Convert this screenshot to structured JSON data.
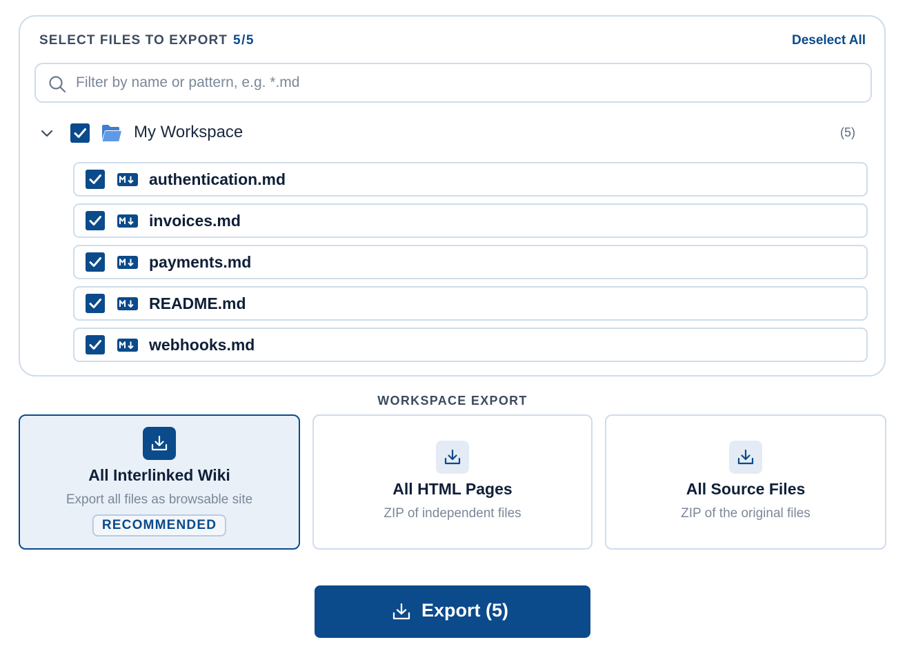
{
  "selection": {
    "title": "SELECT FILES TO EXPORT",
    "count": "5/5",
    "deselect_label": "Deselect All",
    "search_placeholder": "Filter by name or pattern, e.g. *.md",
    "search_value": ""
  },
  "workspace": {
    "name": "My Workspace",
    "count": "(5)",
    "expanded": true,
    "checked": true,
    "icon": "folder-open-icon"
  },
  "files": [
    {
      "name": "authentication.md",
      "checked": true,
      "icon": "markdown-icon"
    },
    {
      "name": "invoices.md",
      "checked": true,
      "icon": "markdown-icon"
    },
    {
      "name": "payments.md",
      "checked": true,
      "icon": "markdown-icon"
    },
    {
      "name": "README.md",
      "checked": true,
      "icon": "markdown-icon"
    },
    {
      "name": "webhooks.md",
      "checked": true,
      "icon": "markdown-icon"
    }
  ],
  "export_section": {
    "label": "WORKSPACE EXPORT",
    "options": [
      {
        "title": "All Interlinked Wiki",
        "description": "Export all files as browsable site",
        "badge": "RECOMMENDED",
        "selected": true,
        "icon": "download-icon"
      },
      {
        "title": "All HTML Pages",
        "description": "ZIP of independent files",
        "selected": false,
        "icon": "download-icon"
      },
      {
        "title": "All Source Files",
        "description": "ZIP of the original files",
        "selected": false,
        "icon": "download-icon"
      }
    ]
  },
  "export_button": {
    "label": "Export (5)",
    "icon": "download-icon"
  },
  "colors": {
    "accent": "#0b4a8b",
    "border": "#cfdceb",
    "selected_bg": "#e9f0f8",
    "muted_text": "#7b8799"
  }
}
